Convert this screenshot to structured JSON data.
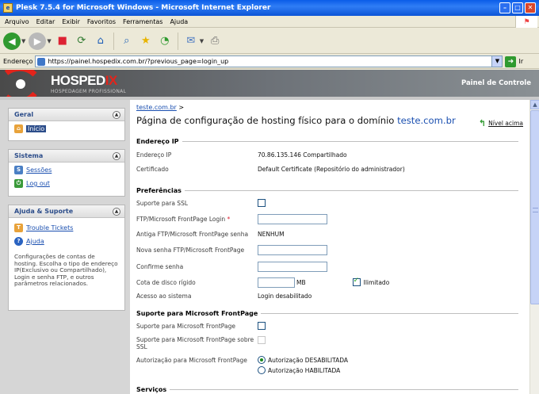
{
  "window": {
    "title": "Plesk 7.5.4 for Microsoft Windows - Microsoft Internet Explorer"
  },
  "menu": [
    "Arquivo",
    "Editar",
    "Exibir",
    "Favoritos",
    "Ferramentas",
    "Ajuda"
  ],
  "address": {
    "label": "Endereço",
    "url": "https://painel.hospedix.com.br/?previous_page=login_up",
    "go": "Ir"
  },
  "banner": {
    "brand_main": "HOSPED",
    "brand_accent": "IX",
    "brand_sub": "HOSPEDAGEM PROFISSIONAL",
    "right_title": "Painel de Controle"
  },
  "sidebar": {
    "geral": {
      "title": "Geral",
      "items": [
        {
          "label": "Início"
        }
      ]
    },
    "sistema": {
      "title": "Sistema",
      "items": [
        {
          "label": "Sessões"
        },
        {
          "label": "Log out"
        }
      ]
    },
    "ajuda": {
      "title": "Ajuda & Suporte",
      "items": [
        {
          "label": "Trouble Tickets"
        },
        {
          "label": "Ajuda"
        }
      ],
      "description": "Configurações de contas de hosting. Escolha o tipo de endereço IP(Exclusivo ou Compartilhado), Login e senha FTP, e outros parâmetros relacionados."
    }
  },
  "main": {
    "breadcrumb": "teste.com.br",
    "breadcrumb_sep": ">",
    "title_prefix": "Página de configuração de hosting físico para o domínio",
    "title_domain": "teste.com.br",
    "up_label": "Nível acima",
    "sections": {
      "ip": {
        "title": "Endereço IP",
        "ip_label": "Endereço IP",
        "ip_value": "70.86.135.146 Compartilhado",
        "cert_label": "Certificado",
        "cert_value": "Default Certificate (Repositório do administrador)"
      },
      "pref": {
        "title": "Preferências",
        "ssl_label": "Suporte para SSL",
        "ftp_login_label": "FTP/Microsoft FrontPage Login",
        "old_pass_label": "Antiga FTP/Microsoft FrontPage senha",
        "old_pass_value": "NENHUM",
        "new_pass_label": "Nova senha FTP/Microsoft FrontPage",
        "confirm_label": "Confirme senha",
        "quota_label": "Cota de disco rígido",
        "quota_unit": "MB",
        "unlimited_label": "Ilimitado",
        "access_label": "Acesso ao sistema",
        "access_value": "Login desabilitado"
      },
      "frontpage": {
        "title": "Suporte para Microsoft FrontPage",
        "fp_label": "Suporte para Microsoft FrontPage",
        "fp_ssl_label": "Suporte para Microsoft FrontPage sobre SSL",
        "auth_label": "Autorização para Microsoft FrontPage",
        "auth_opt1": "Autorização DESABILITADA",
        "auth_opt2": "Autorização HABILITADA"
      },
      "services": {
        "title": "Serviços"
      }
    }
  }
}
